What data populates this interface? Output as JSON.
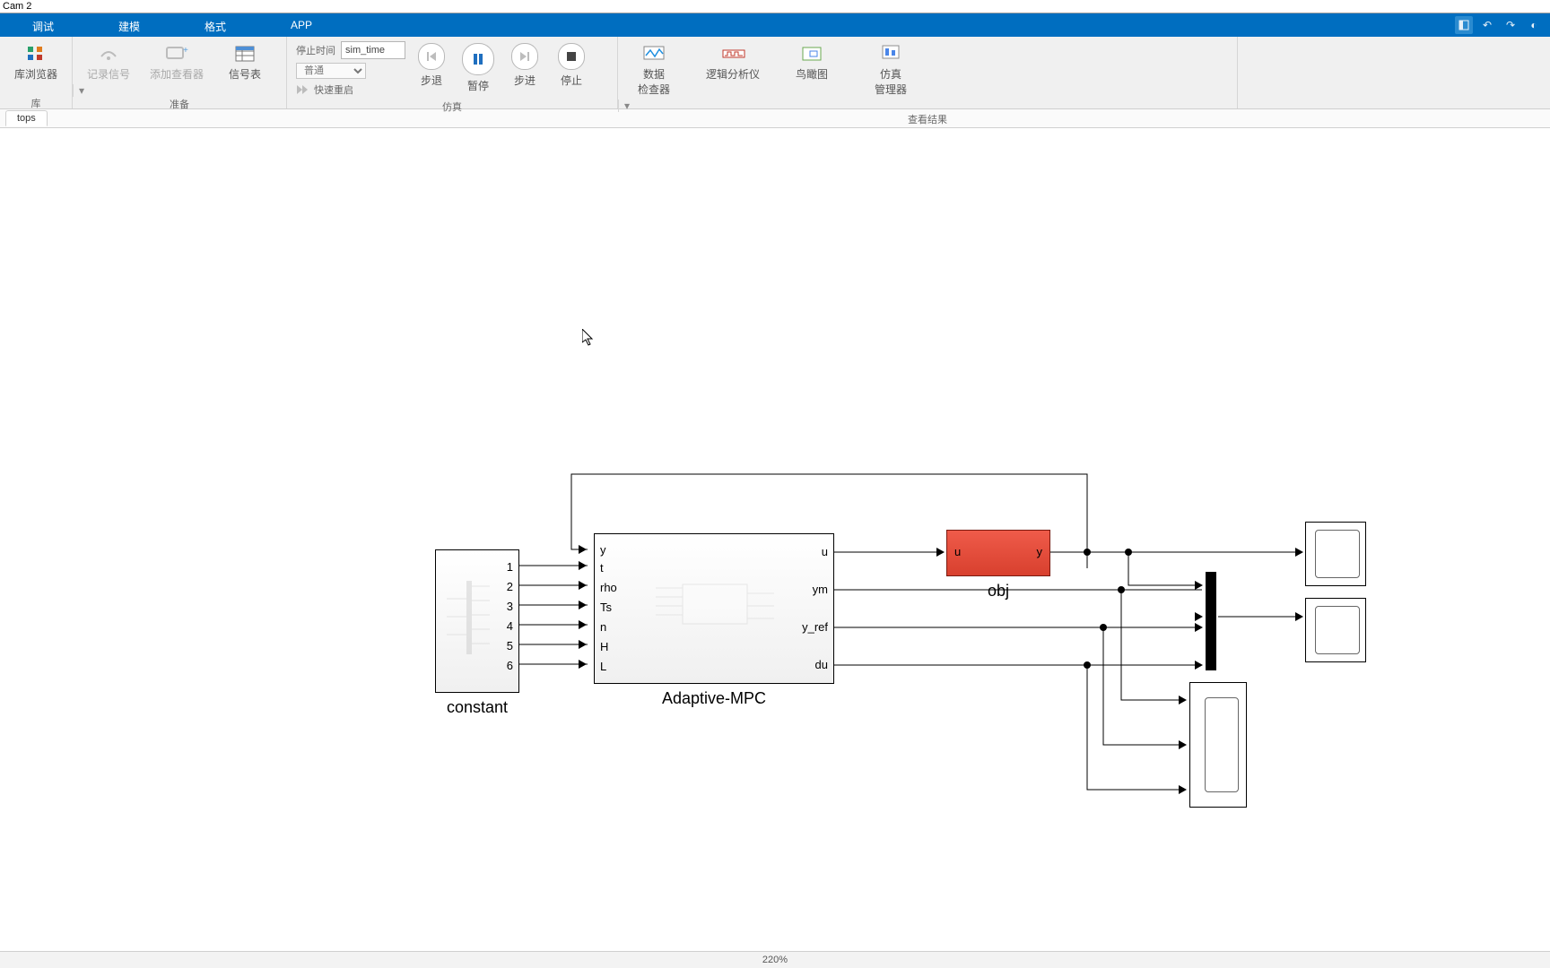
{
  "title_suffix": "Cam 2",
  "menu": {
    "tabs": [
      "调试",
      "建模",
      "格式",
      "APP"
    ]
  },
  "ribbon": {
    "group_library": {
      "label": "库",
      "btn": "库浏览器"
    },
    "group_prepare": {
      "label": "准备",
      "btn_log": "记录信号",
      "btn_addviewer": "添加查看器",
      "btn_sigtable": "信号表"
    },
    "group_sim": {
      "label": "仿真",
      "stoptime_label": "停止时间",
      "stoptime_value": "sim_time",
      "mode_label": "普通",
      "fastrestart": "快速重启",
      "stepback": "步退",
      "pause": "暂停",
      "stepfwd": "步进",
      "stop": "停止"
    },
    "group_results": {
      "label": "查看结果",
      "btn_datainsp": "数据\n检查器",
      "btn_logic": "逻辑分析仪",
      "btn_bird": "鸟瞰图",
      "btn_simmgr": "仿真\n管理器"
    }
  },
  "crumb": "tops",
  "zoom": "220%",
  "blocks": {
    "constant": {
      "label": "constant",
      "ports": [
        "1",
        "2",
        "3",
        "4",
        "5",
        "6"
      ]
    },
    "mpc": {
      "label": "Adaptive-MPC",
      "in": [
        "y",
        "t",
        "rho",
        "Ts",
        "n",
        "H",
        "L"
      ],
      "out": [
        "u",
        "ym",
        "y_ref",
        "du"
      ]
    },
    "obj": {
      "label": "obj",
      "in": "u",
      "out": "y"
    }
  }
}
